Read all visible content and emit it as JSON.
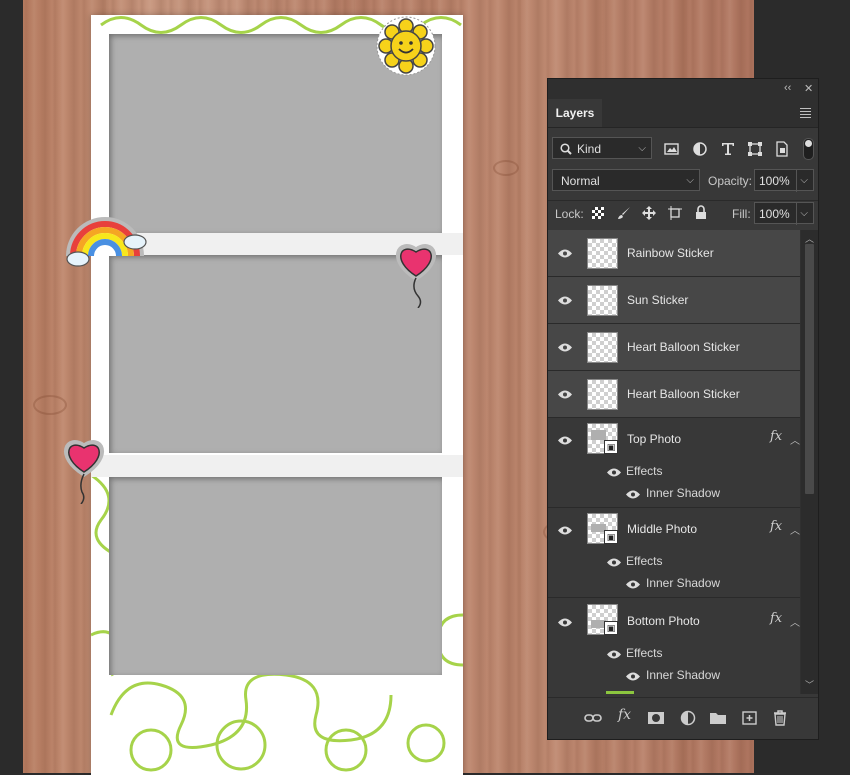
{
  "canvas": {
    "background": "wood",
    "strip_color": "#ffffff",
    "photo_color": "#afafaf",
    "accent_green": "#a6d34a",
    "stickers": [
      "sun-sticker",
      "rainbow-sticker",
      "heart-balloon-sticker",
      "heart-balloon-sticker"
    ]
  },
  "panel": {
    "collapse_icon": "double-chevron-icon",
    "close_icon": "close-icon",
    "tab_label": "Layers",
    "filter": {
      "kind_label": "Kind",
      "icons": [
        "image-filter-icon",
        "adjustment-filter-icon",
        "type-filter-icon",
        "shape-filter-icon",
        "smart-object-filter-icon"
      ]
    },
    "blend_mode": "Normal",
    "opacity_label": "Opacity:",
    "opacity_value": "100%",
    "lock_label": "Lock:",
    "lock_icons": [
      "lock-transparent-icon",
      "lock-image-icon",
      "lock-position-icon",
      "lock-artboard-icon",
      "lock-all-icon"
    ],
    "fill_label": "Fill:",
    "fill_value": "100%",
    "layers": [
      {
        "name": "Rainbow Sticker",
        "selected": true
      },
      {
        "name": "Sun Sticker",
        "selected": true
      },
      {
        "name": "Heart Balloon Sticker",
        "selected": true
      },
      {
        "name": "Heart Balloon Sticker",
        "selected": true
      },
      {
        "name": "Top Photo",
        "fx": "fx",
        "effects_label": "Effects",
        "effect": "Inner Shadow"
      },
      {
        "name": "Middle Photo",
        "fx": "fx",
        "effects_label": "Effects",
        "effect": "Inner Shadow"
      },
      {
        "name": "Bottom Photo",
        "fx": "fx",
        "effects_label": "Effects",
        "effect": "Inner Shadow"
      }
    ],
    "footer_icons": [
      "link-layers-icon",
      "fx-icon",
      "mask-icon",
      "adjustment-layer-icon",
      "group-folder-icon",
      "new-layer-icon",
      "trash-icon"
    ],
    "colors": {
      "panel_bg": "#383838",
      "selected_row": "#474747",
      "text": "#e6e6e6"
    }
  }
}
